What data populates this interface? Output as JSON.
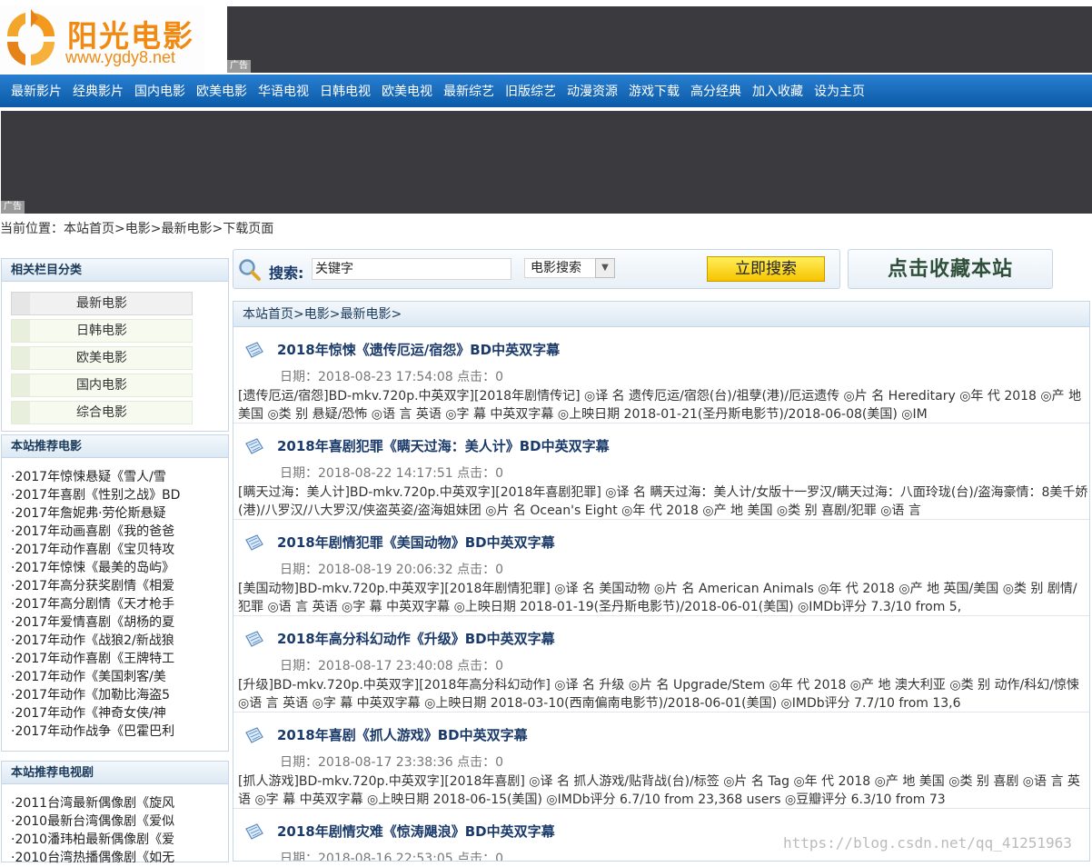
{
  "logo": {
    "title": "阳光电影",
    "url": "www.ygdy8.net"
  },
  "ads": {
    "tag": "广告"
  },
  "nav": [
    "最新影片",
    "经典影片",
    "国内电影",
    "欧美电影",
    "华语电视",
    "日韩电视",
    "欧美电视",
    "最新综艺",
    "旧版综艺",
    "动漫资源",
    "游戏下载",
    "高分经典",
    "加入收藏",
    "设为主页"
  ],
  "breadcrumb": "当前位置：本站首页>电影>最新电影>下载页面",
  "search": {
    "label": "搜索:",
    "value": "关键字",
    "select": "电影搜索",
    "button": "立即搜索",
    "favorite": "点击收藏本站"
  },
  "sidebar": {
    "categories_title": "相关栏目分类",
    "categories": [
      "最新电影",
      "日韩电影",
      "欧美电影",
      "国内电影",
      "综合电影"
    ],
    "movies_title": "本站推荐电影",
    "movies": [
      "·2017年惊悚悬疑《雪人/雪",
      "·2017年喜剧《性别之战》BD",
      "·2017年詹妮弗·劳伦斯悬疑",
      "·2017年动画喜剧《我的爸爸",
      "·2017年动作喜剧《宝贝特攻",
      "·2017年惊悚《最美的岛屿》",
      "·2017年高分获奖剧情《相爱",
      "·2017年高分剧情《天才枪手",
      "·2017年爱情喜剧《胡杨的夏",
      "·2017年动作《战狼2/新战狼",
      "·2017年动作喜剧《王牌特工",
      "·2017年动作《美国刺客/美",
      "·2017年动作《加勒比海盗5",
      "·2017年动作《神奇女侠/神",
      "·2017年动作战争《巴霍巴利"
    ],
    "tv_title": "本站推荐电视剧",
    "tv": [
      "·2011台湾最新偶像剧《旋风",
      "·2010最新台湾偶像剧《爱似",
      "·2010潘玮柏最新偶像剧《爱",
      "·2010台湾热播偶像剧《如无"
    ]
  },
  "main": {
    "crumb": "本站首页>电影>最新电影>",
    "items": [
      {
        "title": "2018年惊悚《遗传厄运/宿怨》BD中英双字幕",
        "meta": "日期：2018-08-23 17:54:08 点击：0",
        "desc": "[遗传厄运/宿怨]BD-mkv.720p.中英双字][2018年剧情传记] ◎译 名 遗传厄运/宿怨(台)/祖孽(港)/厄运遗传 ◎片 名 Hereditary ◎年 代 2018 ◎产 地 美国 ◎类 别 悬疑/恐怖 ◎语 言 英语 ◎字 幕 中英双字幕 ◎上映日期 2018-01-21(圣丹斯电影节)/2018-06-08(美国) ◎IM"
      },
      {
        "title": "2018年喜剧犯罪《瞒天过海：美人计》BD中英双字幕",
        "meta": "日期：2018-08-22 14:17:51 点击：0",
        "desc": "[瞒天过海：美人计]BD-mkv.720p.中英双字][2018年喜剧犯罪] ◎译 名 瞒天过海：美人计/女版十一罗汉/瞒天过海：八面玲珑(台)/盗海豪情：8美千娇(港)/八罗汉/八大罗汉/侠盗英姿/盗海姐妹团 ◎片 名 Ocean's Eight ◎年 代 2018 ◎产 地 美国 ◎类 别 喜剧/犯罪 ◎语 言"
      },
      {
        "title": "2018年剧情犯罪《美国动物》BD中英双字幕",
        "meta": "日期：2018-08-19 20:06:32 点击：0",
        "desc": "[美国动物]BD-mkv.720p.中英双字][2018年剧情犯罪] ◎译 名 美国动物 ◎片 名 American Animals ◎年 代 2018 ◎产 地 英国/美国 ◎类 别 剧情/犯罪 ◎语 言 英语 ◎字 幕 中英双字幕 ◎上映日期 2018-01-19(圣丹斯电影节)/2018-06-01(美国) ◎IMDb评分 7.3/10 from 5,"
      },
      {
        "title": "2018年高分科幻动作《升级》BD中英双字幕",
        "meta": "日期：2018-08-17 23:40:08 点击：0",
        "desc": "[升级]BD-mkv.720p.中英双字][2018年高分科幻动作] ◎译 名 升级 ◎片 名 Upgrade/Stem ◎年 代 2018 ◎产 地 澳大利亚 ◎类 别 动作/科幻/惊悚 ◎语 言 英语 ◎字 幕 中英双字幕 ◎上映日期 2018-03-10(西南偏南电影节)/2018-06-01(美国) ◎IMDb评分 7.7/10 from 13,6"
      },
      {
        "title": "2018年喜剧《抓人游戏》BD中英双字幕",
        "meta": "日期：2018-08-17 23:38:36 点击：0",
        "desc": "[抓人游戏]BD-mkv.720p.中英双字][2018年喜剧] ◎译 名 抓人游戏/贴背战(台)/标签 ◎片 名 Tag ◎年 代 2018 ◎产 地 美国 ◎类 别 喜剧 ◎语 言 英语 ◎字 幕 中英双字幕 ◎上映日期 2018-06-15(美国) ◎IMDb评分 6.7/10 from 23,368 users ◎豆瓣评分 6.3/10 from 73"
      },
      {
        "title": "2018年剧情灾难《惊涛飓浪》BD中英双字幕",
        "meta": "日期：2018-08-16 22:53:05 点击：0",
        "desc": ""
      }
    ]
  },
  "watermark": "https://blog.csdn.net/qq_41251963"
}
